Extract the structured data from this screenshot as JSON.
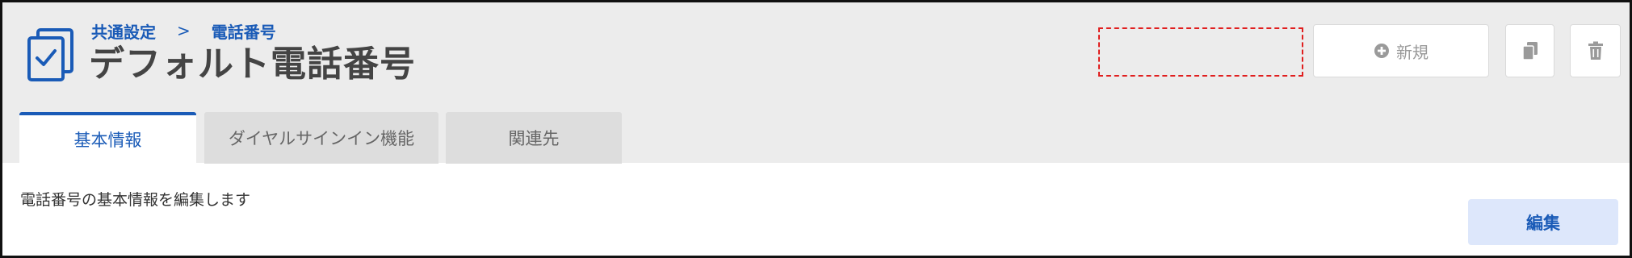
{
  "breadcrumb": {
    "items": [
      "共通設定",
      "電話番号"
    ],
    "separator": ">"
  },
  "page": {
    "title": "デフォルト電話番号",
    "description": "電話番号の基本情報を編集します"
  },
  "actions": {
    "new_label": "新規",
    "new_icon": "plus-circle-icon",
    "copy_icon": "copy-icon",
    "delete_icon": "trash-icon",
    "edit_label": "編集"
  },
  "tabs": [
    {
      "label": "基本情報",
      "active": true
    },
    {
      "label": "ダイヤルサインイン機能",
      "active": false
    },
    {
      "label": "関連先",
      "active": false
    }
  ],
  "colors": {
    "accent": "#1a5bb7",
    "header_bg": "#ececec",
    "placeholder_border": "#e01f1f",
    "edit_button_bg": "#dde7fb"
  }
}
